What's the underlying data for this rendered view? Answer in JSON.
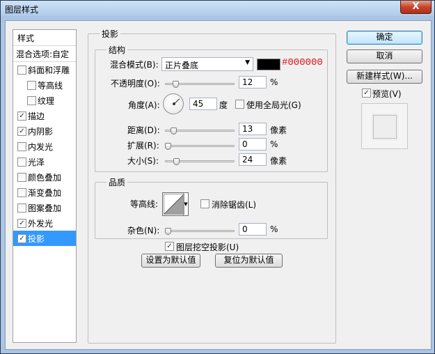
{
  "window": {
    "title": "图层样式",
    "close_label": "X"
  },
  "styles_panel": {
    "header": "样式",
    "blend_options": "混合选项:自定",
    "items": [
      {
        "label": "斜面和浮雕",
        "checked": false,
        "indent": false
      },
      {
        "label": "等高线",
        "checked": false,
        "indent": true
      },
      {
        "label": "纹理",
        "checked": false,
        "indent": true
      },
      {
        "label": "描边",
        "checked": true,
        "indent": false
      },
      {
        "label": "内阴影",
        "checked": true,
        "indent": false
      },
      {
        "label": "内发光",
        "checked": false,
        "indent": false
      },
      {
        "label": "光泽",
        "checked": false,
        "indent": false
      },
      {
        "label": "颜色叠加",
        "checked": false,
        "indent": false
      },
      {
        "label": "渐变叠加",
        "checked": false,
        "indent": false
      },
      {
        "label": "图案叠加",
        "checked": false,
        "indent": false
      },
      {
        "label": "外发光",
        "checked": true,
        "indent": false
      },
      {
        "label": "投影",
        "checked": true,
        "indent": false,
        "selected": true
      }
    ]
  },
  "drop_shadow": {
    "title": "投影",
    "structure": {
      "title": "结构",
      "blend_mode_label": "混合模式(B):",
      "blend_mode_value": "正片叠底",
      "color": "#000000",
      "color_text": "#000000",
      "opacity_label": "不透明度(O):",
      "opacity_value": "12",
      "opacity_unit": "%",
      "angle_label": "角度(A):",
      "angle_value": "45",
      "angle_unit": "度",
      "global_light_label": "使用全局光(G)",
      "global_light_checked": false,
      "distance_label": "距离(D):",
      "distance_value": "13",
      "distance_unit": "像素",
      "spread_label": "扩展(R):",
      "spread_value": "0",
      "spread_unit": "%",
      "size_label": "大小(S):",
      "size_value": "24",
      "size_unit": "像素"
    },
    "quality": {
      "title": "品质",
      "contour_label": "等高线:",
      "anti_alias_label": "消除锯齿(L)",
      "anti_alias_checked": false,
      "noise_label": "杂色(N):",
      "noise_value": "0",
      "noise_unit": "%"
    },
    "knockout_label": "图层挖空投影(U)",
    "knockout_checked": true,
    "make_default_label": "设置为默认值",
    "reset_default_label": "复位为默认值"
  },
  "actions": {
    "ok_label": "确定",
    "cancel_label": "取消",
    "new_style_label": "新建样式(W)...",
    "preview_label": "预览(V)",
    "preview_checked": true
  }
}
